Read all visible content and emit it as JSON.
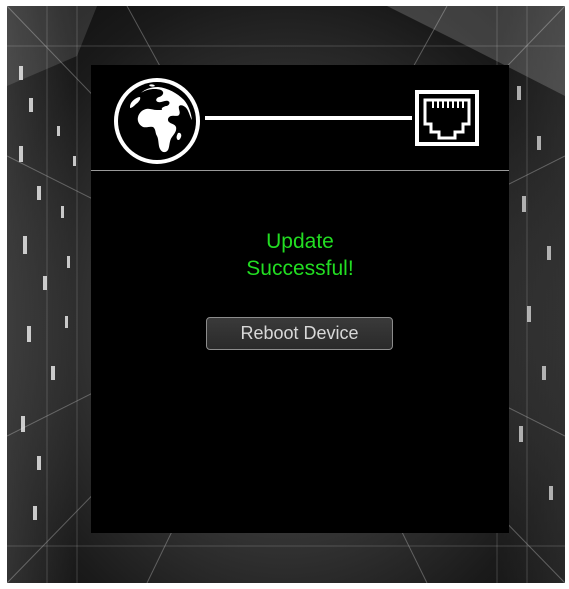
{
  "status": {
    "line1": "Update",
    "line2": "Successful!",
    "color": "#22dd22"
  },
  "actions": {
    "reboot_label": "Reboot Device"
  },
  "icons": {
    "internet": "globe-icon",
    "connection": "connection-line",
    "port": "ethernet-port-icon"
  }
}
